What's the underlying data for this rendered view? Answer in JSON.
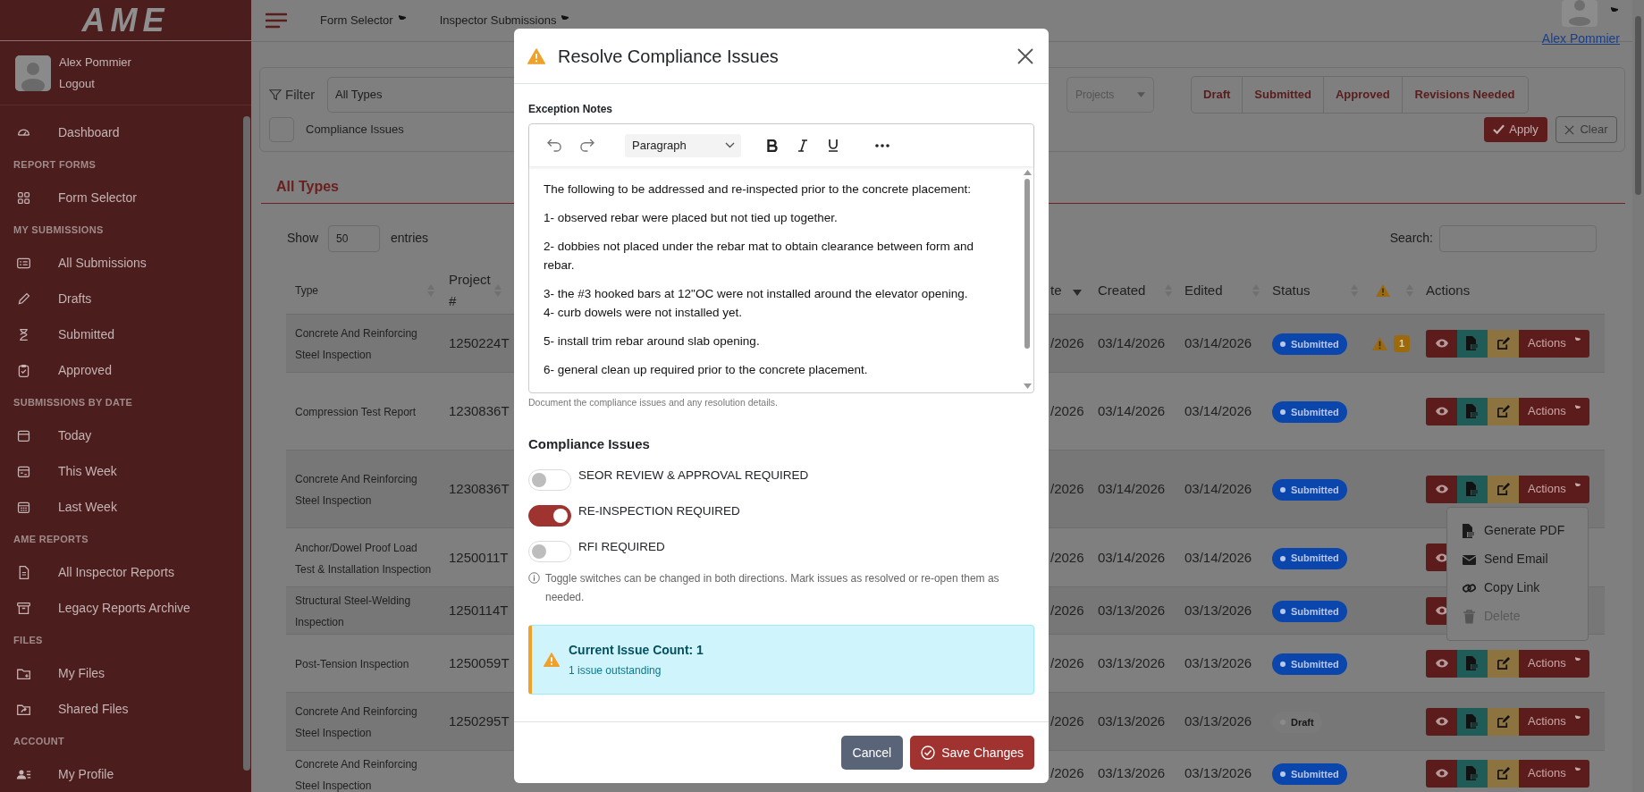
{
  "sidebar": {
    "logo": "AME",
    "user": {
      "name": "Alex Pommier",
      "logout": "Logout"
    },
    "sections": [
      {
        "items": [
          "Dashboard"
        ]
      },
      {
        "heading": "REPORT FORMS",
        "items": [
          "Form Selector"
        ]
      },
      {
        "heading": "MY SUBMISSIONS",
        "items": [
          "All Submissions",
          "Drafts",
          "Submitted",
          "Approved"
        ]
      },
      {
        "heading": "SUBMISSIONS BY DATE",
        "items": [
          "Today",
          "This Week",
          "Last Week"
        ]
      },
      {
        "heading": "AME REPORTS",
        "items": [
          "All Inspector Reports",
          "Legacy Reports Archive"
        ]
      },
      {
        "heading": "FILES",
        "items": [
          "My Files",
          "Shared Files"
        ]
      },
      {
        "heading": "ACCOUNT",
        "items": [
          "My Profile"
        ]
      }
    ]
  },
  "topbar": {
    "links": [
      "Form Selector",
      "Inspector Submissions"
    ],
    "user_name": "Alex Pommier"
  },
  "filter": {
    "label": "Filter",
    "type_select": "All Types",
    "projects_placeholder": "Projects",
    "status_buttons": [
      {
        "label": "Draft",
        "selected": false
      },
      {
        "label": "Submitted",
        "selected": false
      },
      {
        "label": "Approved",
        "selected": false
      },
      {
        "label": "Revisions Needed",
        "selected": false
      }
    ],
    "compliance_checkbox": {
      "label": "Compliance Issues",
      "checked": false
    },
    "apply": "Apply",
    "clear": "Clear"
  },
  "card": {
    "title": "All Types",
    "show_label": "Show",
    "entries_value": "50",
    "entries_label": "entries",
    "search_label": "Search:"
  },
  "table": {
    "columns": [
      {
        "label": "Type",
        "sorted": false
      },
      {
        "label": "Project #",
        "sorted": false
      },
      {
        "label": "te",
        "sorted": true
      },
      {
        "label": "Created",
        "sorted": false
      },
      {
        "label": "Edited",
        "sorted": false
      },
      {
        "label": "Status",
        "sorted": false
      },
      {
        "kind": "warning",
        "sorted": false
      },
      {
        "label": "Actions"
      }
    ],
    "rows": [
      {
        "type": "Concrete And Reinforcing Steel Inspection",
        "project": "1250224T",
        "date": "/2026",
        "created": "03/14/2026",
        "edited": "03/14/2026",
        "status": {
          "label": "Submitted",
          "kind": "submitted"
        },
        "issues": "1",
        "actions": "Actions",
        "menu_open": false
      },
      {
        "type": "Compression Test Report",
        "project": "1230836T",
        "date": "/2026",
        "created": "03/14/2026",
        "edited": "03/14/2026",
        "status": {
          "label": "Submitted",
          "kind": "submitted"
        },
        "actions": "Actions",
        "menu_open": false
      },
      {
        "type": "Concrete And Reinforcing Steel Inspection",
        "project": "1230836T",
        "date": "/2026",
        "created": "03/14/2026",
        "edited": "03/14/2026",
        "status": {
          "label": "Submitted",
          "kind": "submitted"
        },
        "actions": "Actions",
        "menu_open": true
      },
      {
        "type": "Anchor/Dowel Proof Load Test & Installation Inspection",
        "project": "1250011T",
        "date": "/2026",
        "created": "03/14/2026",
        "edited": "03/14/2026",
        "status": {
          "label": "Submitted",
          "kind": "submitted"
        },
        "menu_open": false
      },
      {
        "type": "Structural Steel-Welding Inspection",
        "project": "1250114T",
        "date": "/2026",
        "created": "03/13/2026",
        "edited": "03/13/2026",
        "status": {
          "label": "Submitted",
          "kind": "submitted"
        },
        "menu_open": false
      },
      {
        "type": "Post-Tension Inspection",
        "project": "1250059T",
        "date": "/2026",
        "created": "03/13/2026",
        "edited": "03/13/2026",
        "status": {
          "label": "Submitted",
          "kind": "submitted"
        },
        "actions": "Actions",
        "menu_open": false
      },
      {
        "type": "Concrete And Reinforcing Steel Inspection",
        "project": "1250295T",
        "date": "/2026",
        "created": "03/13/2026",
        "edited": "03/13/2026",
        "status": {
          "label": "Draft",
          "kind": "draft"
        },
        "actions": "Actions",
        "menu_open": false
      },
      {
        "type": "Concrete And Reinforcing Steel Inspection",
        "date": "/2026",
        "created": "03/13/2026",
        "edited": "03/13/2026",
        "status": {
          "label": "Submitted",
          "kind": "submitted"
        },
        "actions": "Actions",
        "menu_open": false
      }
    ],
    "menu": {
      "items": [
        {
          "label": "Generate PDF",
          "disabled": false
        },
        {
          "label": "Send Email",
          "disabled": false
        },
        {
          "label": "Copy Link",
          "disabled": false
        },
        {
          "label": "Delete",
          "disabled": true
        }
      ]
    }
  },
  "modal": {
    "title": "Resolve Compliance Issues",
    "notes_label": "Exception Notes",
    "block_format": "Paragraph",
    "notes": [
      [
        "The following to be addressed and re-inspected prior to the concrete placement:"
      ],
      [
        "1- observed rebar were placed but not tied up together."
      ],
      [
        "2- dobbies not placed under the rebar mat to obtain clearance between form and rebar."
      ],
      [
        "3- the #3 hooked bars at 12\"OC were not installed around the elevator opening.",
        "4- curb dowels were not installed yet."
      ],
      [
        "5- install trim rebar around slab opening."
      ],
      [
        "6- general clean up required prior to the concrete placement."
      ]
    ],
    "notes_help": "Document the compliance issues and any resolution details.",
    "issues_heading": "Compliance Issues",
    "toggles": [
      {
        "label": "SEOR REVIEW & APPROVAL REQUIRED",
        "on": false
      },
      {
        "label": "RE-INSPECTION REQUIRED",
        "on": true
      },
      {
        "label": "RFI REQUIRED",
        "on": false
      }
    ],
    "info": "Toggle switches can be changed in both directions. Mark issues as resolved or re-open them as needed.",
    "alert": {
      "title": "Current Issue Count: 1",
      "text": "1 issue outstanding"
    },
    "cancel": "Cancel",
    "save": "Save Changes"
  }
}
